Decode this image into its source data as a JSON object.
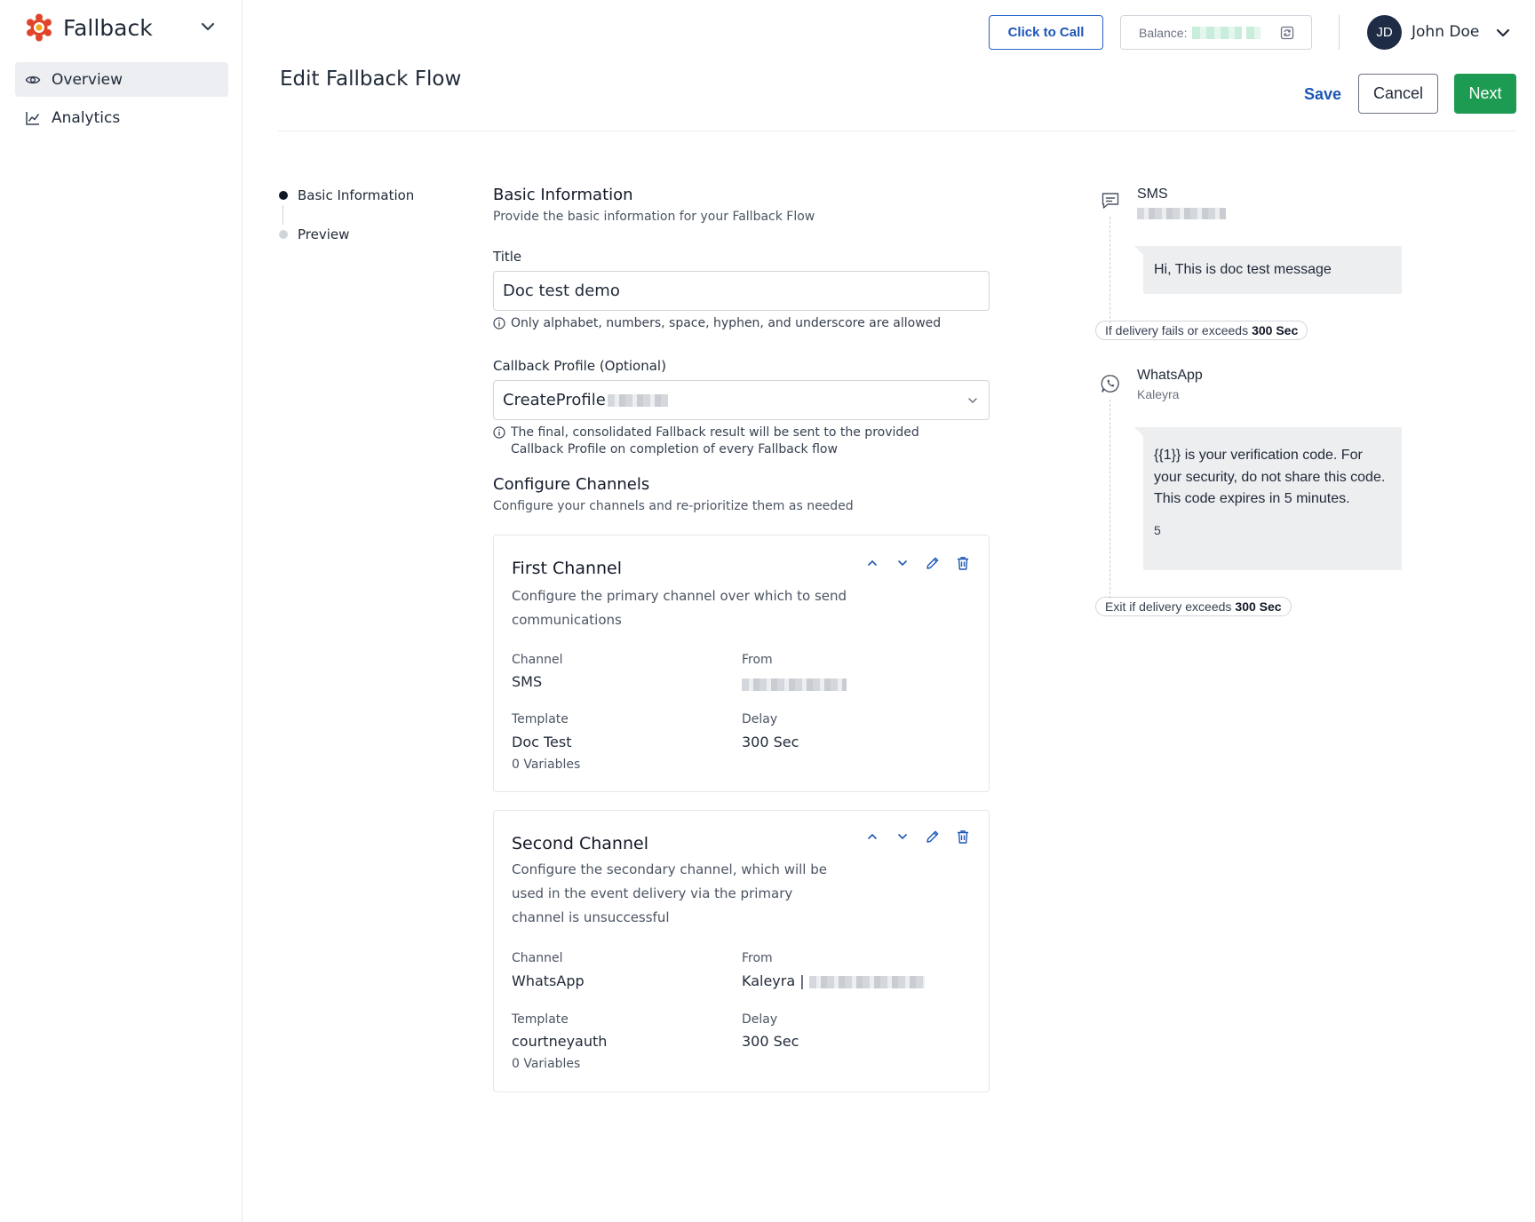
{
  "sidebar": {
    "app_name": "Fallback",
    "items": [
      {
        "label": "Overview",
        "icon": "eye-icon"
      },
      {
        "label": "Analytics",
        "icon": "chart-line-icon"
      }
    ]
  },
  "header": {
    "click_to_call": "Click to Call",
    "balance_label": "Balance:",
    "user_initials": "JD",
    "user_name": "John Doe"
  },
  "page": {
    "title": "Edit Fallback Flow",
    "save": "Save",
    "cancel": "Cancel",
    "next": "Next"
  },
  "steps": [
    {
      "label": "Basic Information",
      "active": true
    },
    {
      "label": "Preview",
      "active": false
    }
  ],
  "basic_info": {
    "title": "Basic Information",
    "subtitle": "Provide the basic information for your Fallback Flow",
    "title_label": "Title",
    "title_value": "Doc test demo",
    "title_hint": "Only alphabet, numbers, space, hyphen, and underscore are allowed",
    "callback_label": "Callback Profile (Optional)",
    "callback_value": "CreateProfile",
    "callback_hint_1": "The final, consolidated Fallback result will be sent to the provided",
    "callback_hint_2": "Callback Profile on completion of every Fallback flow"
  },
  "configure": {
    "title": "Configure Channels",
    "subtitle": "Configure your channels and re-prioritize them as needed"
  },
  "channels": [
    {
      "title": "First Channel",
      "description": "Configure the primary channel over which to send communications",
      "channel_label": "Channel",
      "channel": "SMS",
      "from_label": "From",
      "from": "",
      "template_label": "Template",
      "template": "Doc Test",
      "variables": "0 Variables",
      "delay_label": "Delay",
      "delay": "300 Sec"
    },
    {
      "title": "Second Channel",
      "description": "Configure the secondary channel, which will be used in the event delivery via the primary channel is unsuccessful",
      "channel_label": "Channel",
      "channel": "WhatsApp",
      "from_label": "From",
      "from": "Kaleyra |",
      "template_label": "Template",
      "template": "courtneyauth",
      "variables": "0 Variables",
      "delay_label": "Delay",
      "delay": "300 Sec"
    }
  ],
  "preview": {
    "sms_title": "SMS",
    "sms_message": "Hi, This is doc test message",
    "fallback_pill": "If delivery fails or exceeds",
    "fallback_pill_value": "300 Sec",
    "wa_title": "WhatsApp",
    "wa_sub": "Kaleyra",
    "wa_message": "{{1}} is your verification code. For your security, do not share this code. This code expires in 5 minutes.",
    "wa_footer": "5",
    "exit_pill": "Exit if delivery exceeds",
    "exit_pill_value": "300 Sec"
  },
  "colors": {
    "primary_blue": "#1d55b7",
    "next_green": "#1e9b52",
    "avatar_bg": "#1e2d45",
    "brand_red": "#e0452b"
  }
}
